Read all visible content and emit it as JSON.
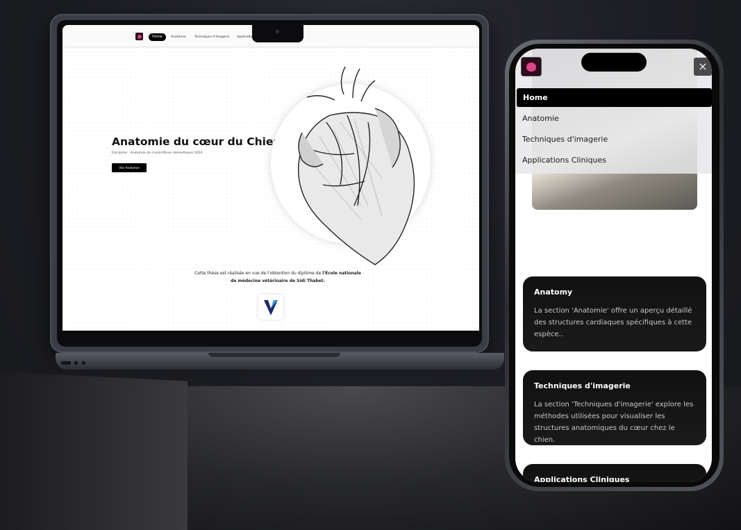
{
  "site": {
    "nav": [
      "Home",
      "Anatomie",
      "Techniques d'imagerie",
      "Applications Cliniques"
    ],
    "hero": {
      "title": "Anatomie du cœur du Chien",
      "subtitle": "Discipline : Anatomie de mammifères domestiques 2024",
      "button": "Voir Anatomie"
    },
    "thesis_prefix": "Cette thèse est réalisée en vue de l'obtention du diplôme de",
    "thesis_school_1": "l'École nationale",
    "thesis_school_2": "de médecine vétérinaire de Sidi Thabet."
  },
  "mobile": {
    "close_icon": "×",
    "menu": {
      "home": "Home",
      "anatomie": "Anatomie",
      "techniques": "Techniques d'imagerie",
      "applications": "Applications Cliniques"
    },
    "cards": [
      {
        "title": "Anatomy",
        "text": "La section 'Anatomie' offre un aperçu détaillé des structures cardiaques spécifiques à cette espèce.."
      },
      {
        "title": "Techniques d'imagerie",
        "text": "La section 'Techniques d'imagerie' explore les méthodes utilisées pour visualiser les structures anatomiques du cœur chez le chien."
      },
      {
        "title": "Applications Cliniques",
        "text": ""
      }
    ]
  },
  "colors": {
    "accent": "#e0428a",
    "dark": "#000000",
    "card": "#111111"
  }
}
